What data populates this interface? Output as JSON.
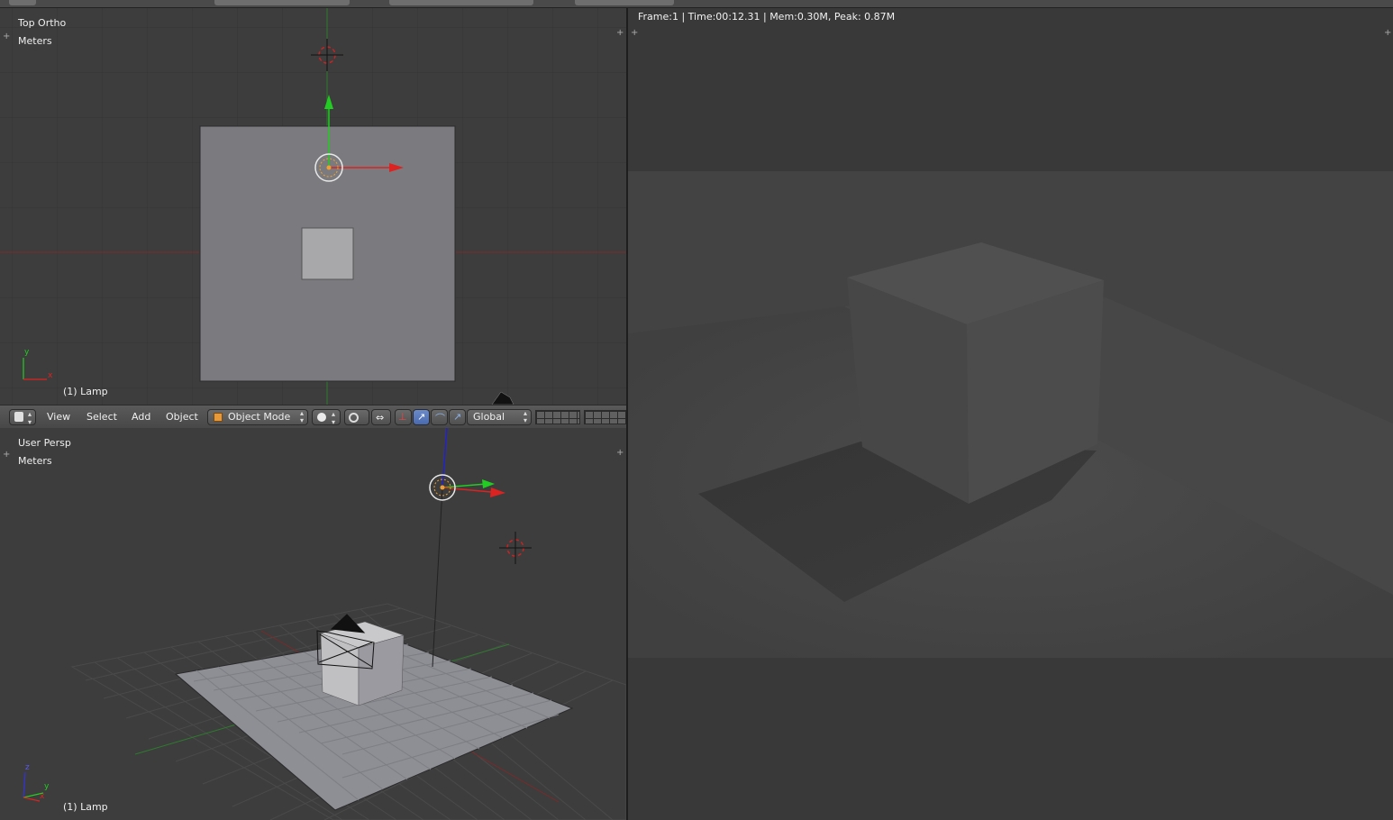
{
  "top_viewport": {
    "view_name": "Top Ortho",
    "units": "Meters",
    "selected_object": "(1) Lamp",
    "axis_x": "x",
    "axis_y": "y"
  },
  "header": {
    "menus": [
      "View",
      "Select",
      "Add",
      "Object"
    ],
    "mode": "Object Mode",
    "orientation": "Global"
  },
  "persp_viewport": {
    "view_name": "User Persp",
    "units": "Meters",
    "selected_object": "(1) Lamp",
    "axis_x": "x",
    "axis_y": "y",
    "axis_z": "z"
  },
  "render": {
    "stats": "Frame:1 | Time:00:12.31 | Mem:0.30M, Peak: 0.87M"
  },
  "colors": {
    "axis_x": "#c83232",
    "axis_y": "#32b432",
    "axis_z": "#3232c8",
    "selection": "#f0a030",
    "viewport_bg": "#3d3d3d"
  }
}
